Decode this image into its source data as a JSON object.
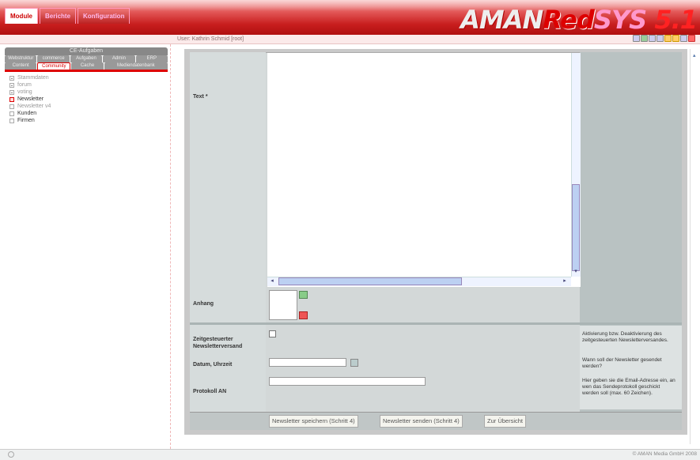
{
  "header": {
    "tabs": [
      "Module",
      "Berichte",
      "Konfiguration"
    ],
    "logo": {
      "part1": "AMAN",
      "part2": "Red",
      "part3": "SYS",
      "part4": "5.1"
    }
  },
  "userbar": {
    "user_label": "User: Kathrin Schmid [root]"
  },
  "sidebar": {
    "title": "CE-Aufgaben",
    "tabs_row1": [
      "Webstruktur",
      "commerce",
      "Aufgaben",
      "Admin",
      "ERP"
    ],
    "tabs_row2": [
      "Content",
      "Community",
      "Cache",
      "Mediendatenbank"
    ],
    "tree": [
      {
        "label": "Stammdaten",
        "state": "plus"
      },
      {
        "label": "forum",
        "state": "plus"
      },
      {
        "label": "voting",
        "state": "plus"
      },
      {
        "label": "Newsletter",
        "state": "active"
      },
      {
        "label": "Newsletter v4",
        "state": "empty"
      },
      {
        "label": "Kunden",
        "state": "empty"
      },
      {
        "label": "Firmen",
        "state": "empty"
      }
    ]
  },
  "form": {
    "text_label": "Text *",
    "attach_label": "Anhang",
    "scheduled_label_line1": "Zeitgesteuerter",
    "scheduled_label_line2": "Newsletterversand",
    "datetime_label": "Datum, Uhrzeit",
    "protocol_label": "Protokoll AN",
    "help_scheduled": "Aktivierung bzw. Deaktivierung des zeitgesteuerten Newsletterversandes.",
    "help_datetime": "Wann soll der Newsletter gesendet werden?",
    "help_protocol": "Hier geben sie die Email-Adresse ein, an wen das Sendeprotokoll geschickt werden soll (max. 60 Zeichen).",
    "datetime_value": "",
    "protocol_value": ""
  },
  "buttons": {
    "save": "Newsletter speichern (Schritt 4)",
    "send": "Newsletter senden (Schritt 4)",
    "overview": "Zur Übersicht"
  },
  "footer": {
    "copyright": "© AMAN Media GmbH 2008"
  }
}
